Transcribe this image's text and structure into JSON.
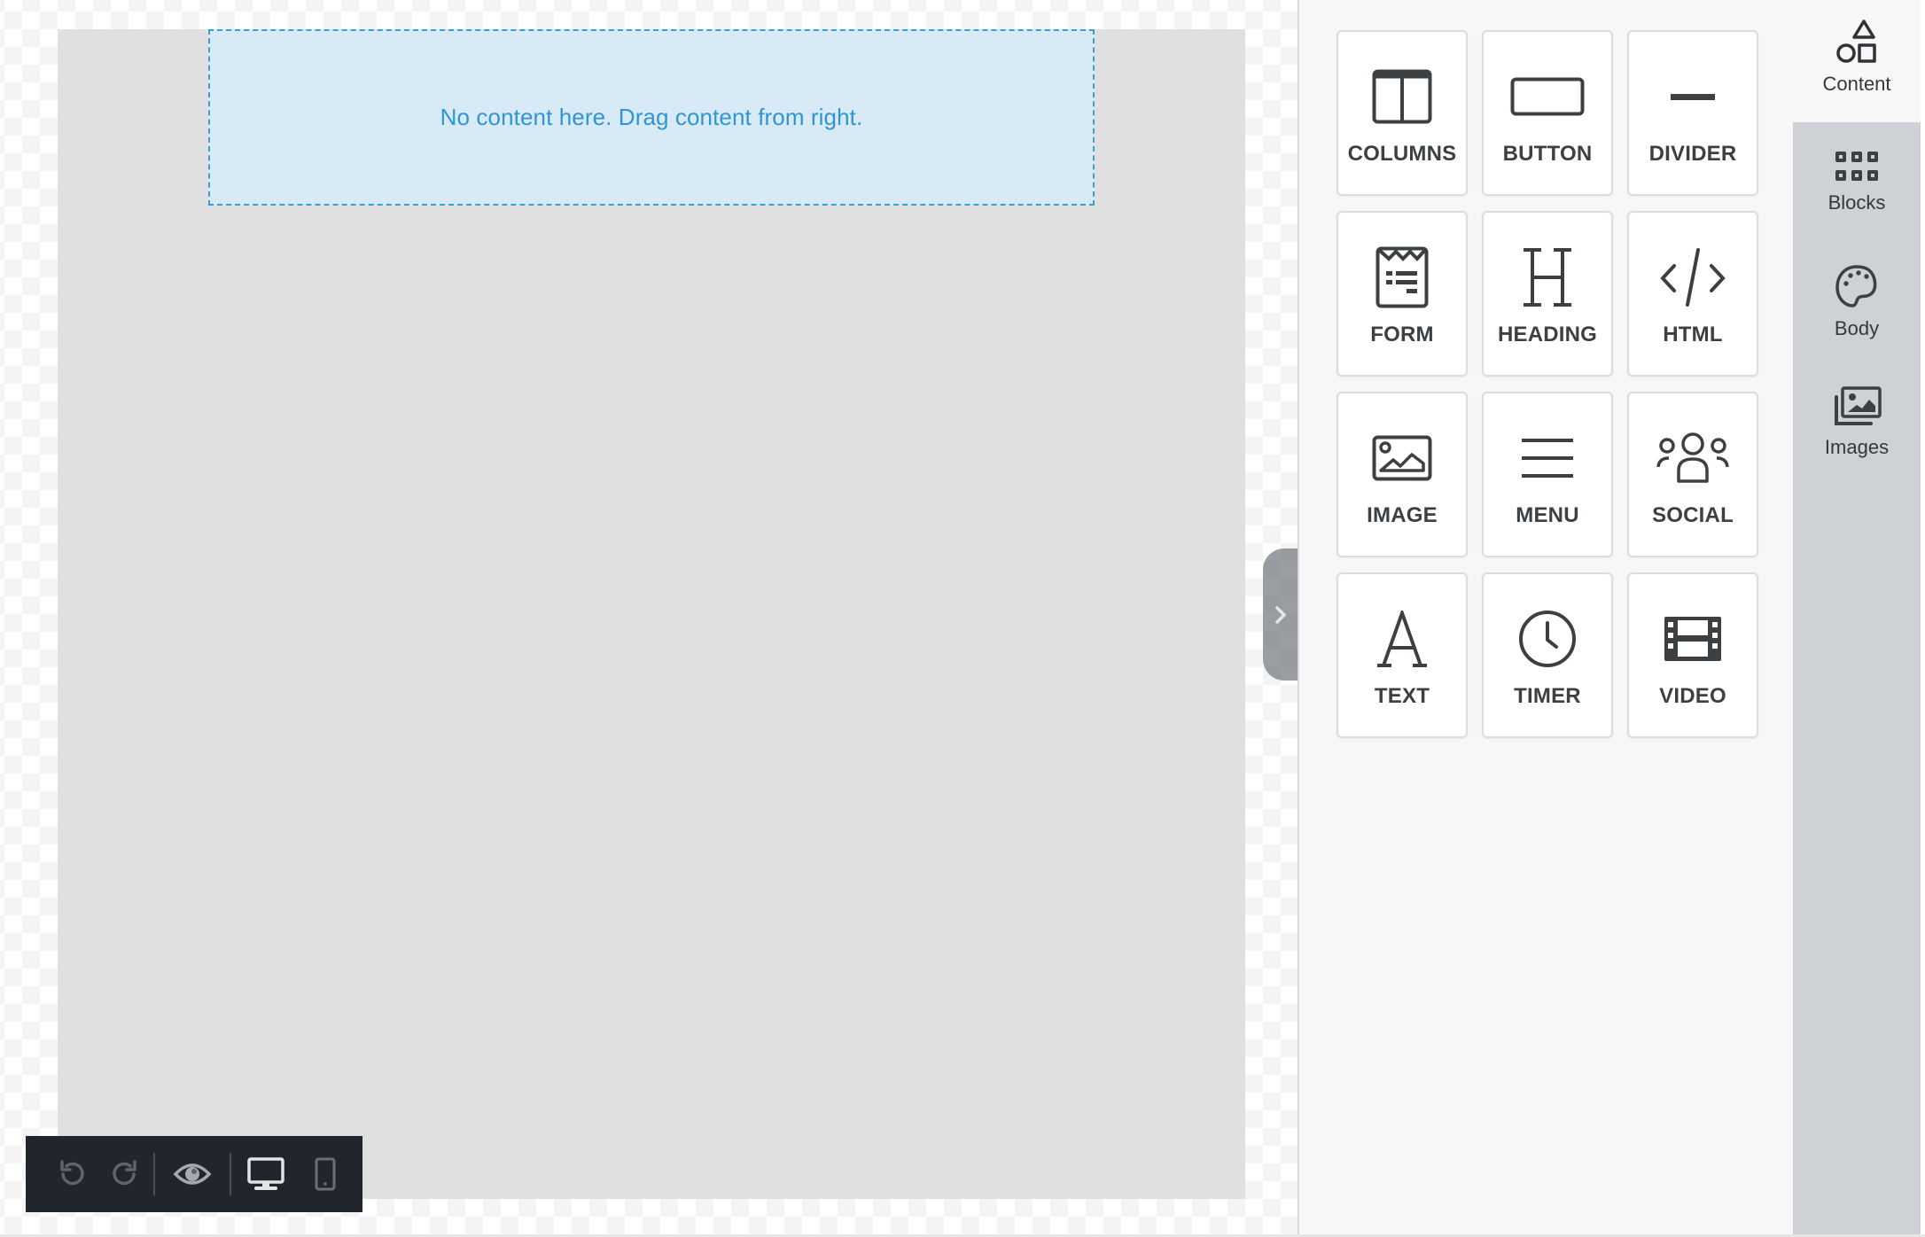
{
  "canvas": {
    "empty_message": "No content here. Drag content from right."
  },
  "toolbar": {
    "buttons": [
      {
        "name": "undo",
        "icon": "undo-icon",
        "enabled": false
      },
      {
        "name": "redo",
        "icon": "redo-icon",
        "enabled": false
      },
      {
        "name": "preview",
        "icon": "eye-icon"
      },
      {
        "name": "desktop-view",
        "icon": "desktop-icon",
        "active": true
      },
      {
        "name": "mobile-view",
        "icon": "mobile-icon"
      }
    ]
  },
  "panel_toggle": {
    "icon": "chevron-right-icon"
  },
  "content_panel": {
    "items": [
      {
        "label": "COLUMNS",
        "icon": "columns-icon"
      },
      {
        "label": "BUTTON",
        "icon": "button-icon"
      },
      {
        "label": "DIVIDER",
        "icon": "divider-icon"
      },
      {
        "label": "FORM",
        "icon": "form-icon"
      },
      {
        "label": "HEADING",
        "icon": "heading-icon"
      },
      {
        "label": "HTML",
        "icon": "code-icon"
      },
      {
        "label": "IMAGE",
        "icon": "image-icon"
      },
      {
        "label": "MENU",
        "icon": "menu-icon"
      },
      {
        "label": "SOCIAL",
        "icon": "social-icon"
      },
      {
        "label": "TEXT",
        "icon": "text-icon"
      },
      {
        "label": "TIMER",
        "icon": "clock-icon"
      },
      {
        "label": "VIDEO",
        "icon": "film-icon"
      }
    ]
  },
  "side_tabs": [
    {
      "label": "Content",
      "icon": "shapes-icon",
      "active": true
    },
    {
      "label": "Blocks",
      "icon": "blocks-icon"
    },
    {
      "label": "Body",
      "icon": "palette-icon"
    },
    {
      "label": "Images",
      "icon": "images-icon"
    }
  ],
  "colors": {
    "accent": "#2f96d3",
    "dropzone_bg": "#d8eaf5",
    "toolbar_bg": "#21252d",
    "icon_dark": "#3c4043"
  }
}
